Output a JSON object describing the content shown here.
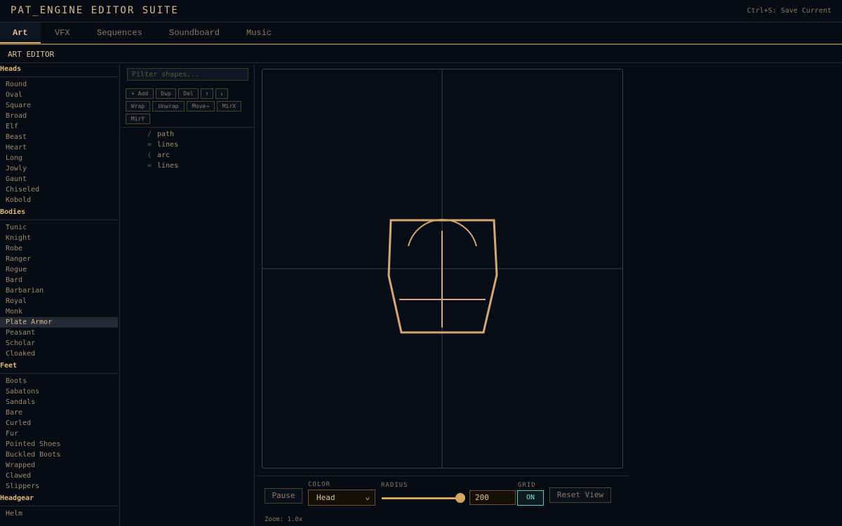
{
  "app": {
    "title": "PAT_ENGINE EDITOR SUITE",
    "shortcut_hint": "Ctrl+S: Save Current"
  },
  "tabs": [
    {
      "label": "Art",
      "active": true
    },
    {
      "label": "VFX"
    },
    {
      "label": "Sequences"
    },
    {
      "label": "Soundboard"
    },
    {
      "label": "Music"
    }
  ],
  "section_title": "ART EDITOR",
  "sidebar": {
    "categories": [
      {
        "title": "Heads",
        "items": [
          "Round",
          "Oval",
          "Square",
          "Broad",
          "Elf",
          "Beast",
          "Heart",
          "Long",
          "Jowly",
          "Gaunt",
          "Chiseled",
          "Kobold"
        ]
      },
      {
        "title": "Bodies",
        "items": [
          "Tunic",
          "Knight",
          "Robe",
          "Ranger",
          "Rogue",
          "Bard",
          "Barbarian",
          "Royal",
          "Monk",
          "Plate Armor",
          "Peasant",
          "Scholar",
          "Cloaked"
        ]
      },
      {
        "title": "Feet",
        "items": [
          "Boots",
          "Sabatons",
          "Sandals",
          "Bare",
          "Curled",
          "Fur",
          "Pointed Shoes",
          "Buckled Boots",
          "Wrapped",
          "Clawed",
          "Slippers"
        ]
      },
      {
        "title": "Headgear",
        "items": [
          "Helm"
        ]
      }
    ],
    "selected": "Plate Armor"
  },
  "shapes": {
    "filter_placeholder": "Filter shapes...",
    "toolbar_row1": [
      "+ Add",
      "Dup",
      "Del",
      "↑",
      "↓"
    ],
    "toolbar_row2": [
      "Wrap",
      "Unwrap",
      "Move→",
      "MirX"
    ],
    "toolbar_row3": [
      "MirY"
    ],
    "list": [
      {
        "glyph": "/",
        "label": "path"
      },
      {
        "glyph": "=",
        "label": "lines"
      },
      {
        "glyph": "(",
        "label": "arc"
      },
      {
        "glyph": "=",
        "label": "lines"
      }
    ]
  },
  "controls": {
    "pause_label": "Pause",
    "color_label": "COLOR",
    "color_value": "Head",
    "radius_label": "RADIUS",
    "radius_value": "200",
    "radius_fraction": 1.0,
    "grid_label": "GRID",
    "grid_value": "ON",
    "reset_label": "Reset View",
    "zoom_text": "Zoom: 1.0x"
  },
  "colors": {
    "accent": "#d4a862",
    "shape_stroke": "#d4a874",
    "grid_toggle": "#5fc8c0",
    "background": "#060b14"
  }
}
